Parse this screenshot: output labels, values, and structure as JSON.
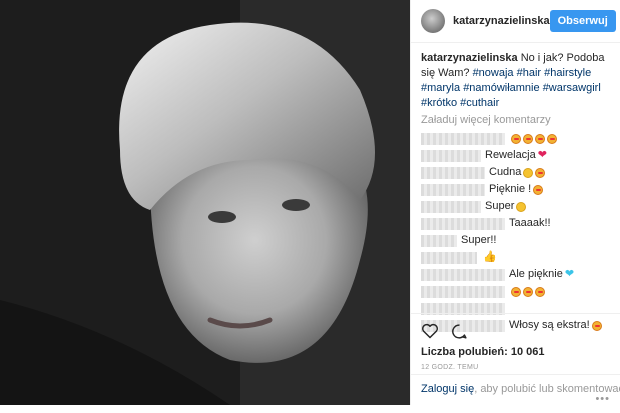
{
  "post": {
    "username": "katarzynazielinska",
    "follow_label": "Obserwuj",
    "caption_user": "katarzynazielinska",
    "caption_text": "No i jak? Podoba się Wam?",
    "hashtags": [
      "#nowaja",
      "#hair",
      "#hairstyle",
      "#maryla",
      "#namówiłamnie",
      "#warsawgirl",
      "#krótko",
      "#cuthair"
    ],
    "load_more": "Załaduj więcej komentarzy",
    "comments": [
      {
        "text": "",
        "emoji": [
          "heart-eyes",
          "heart-eyes",
          "heart-eyes",
          "heart-eyes"
        ]
      },
      {
        "text": "Rewelacja",
        "emoji": [
          "red-heart"
        ]
      },
      {
        "text": "Cudna",
        "emoji": [
          "smile",
          "heart-eyes"
        ]
      },
      {
        "text": "Pięknie !",
        "emoji": [
          "heart-eyes"
        ]
      },
      {
        "text": "Super",
        "emoji": [
          "smile"
        ]
      },
      {
        "text": "Taaaak!!",
        "emoji": []
      },
      {
        "text": "Super!!",
        "emoji": []
      },
      {
        "text": "",
        "emoji": [
          "thumbs-up"
        ]
      },
      {
        "text": "Ale pięknie",
        "emoji": [
          "blue-heart"
        ]
      },
      {
        "text": "",
        "emoji": [
          "heart-eyes",
          "heart-eyes",
          "heart-eyes"
        ]
      },
      {
        "text": "",
        "emoji": []
      },
      {
        "text": "Włosy są ekstra!",
        "emoji": [
          "heart-eyes"
        ]
      }
    ],
    "likes_label": "Liczba polubień: 10 061",
    "timestamp": "12 GODZ. TEMU",
    "login_link": "Zaloguj się",
    "login_rest": ", aby polubić lub skomentować.",
    "more_icon": "more-options-icon"
  }
}
